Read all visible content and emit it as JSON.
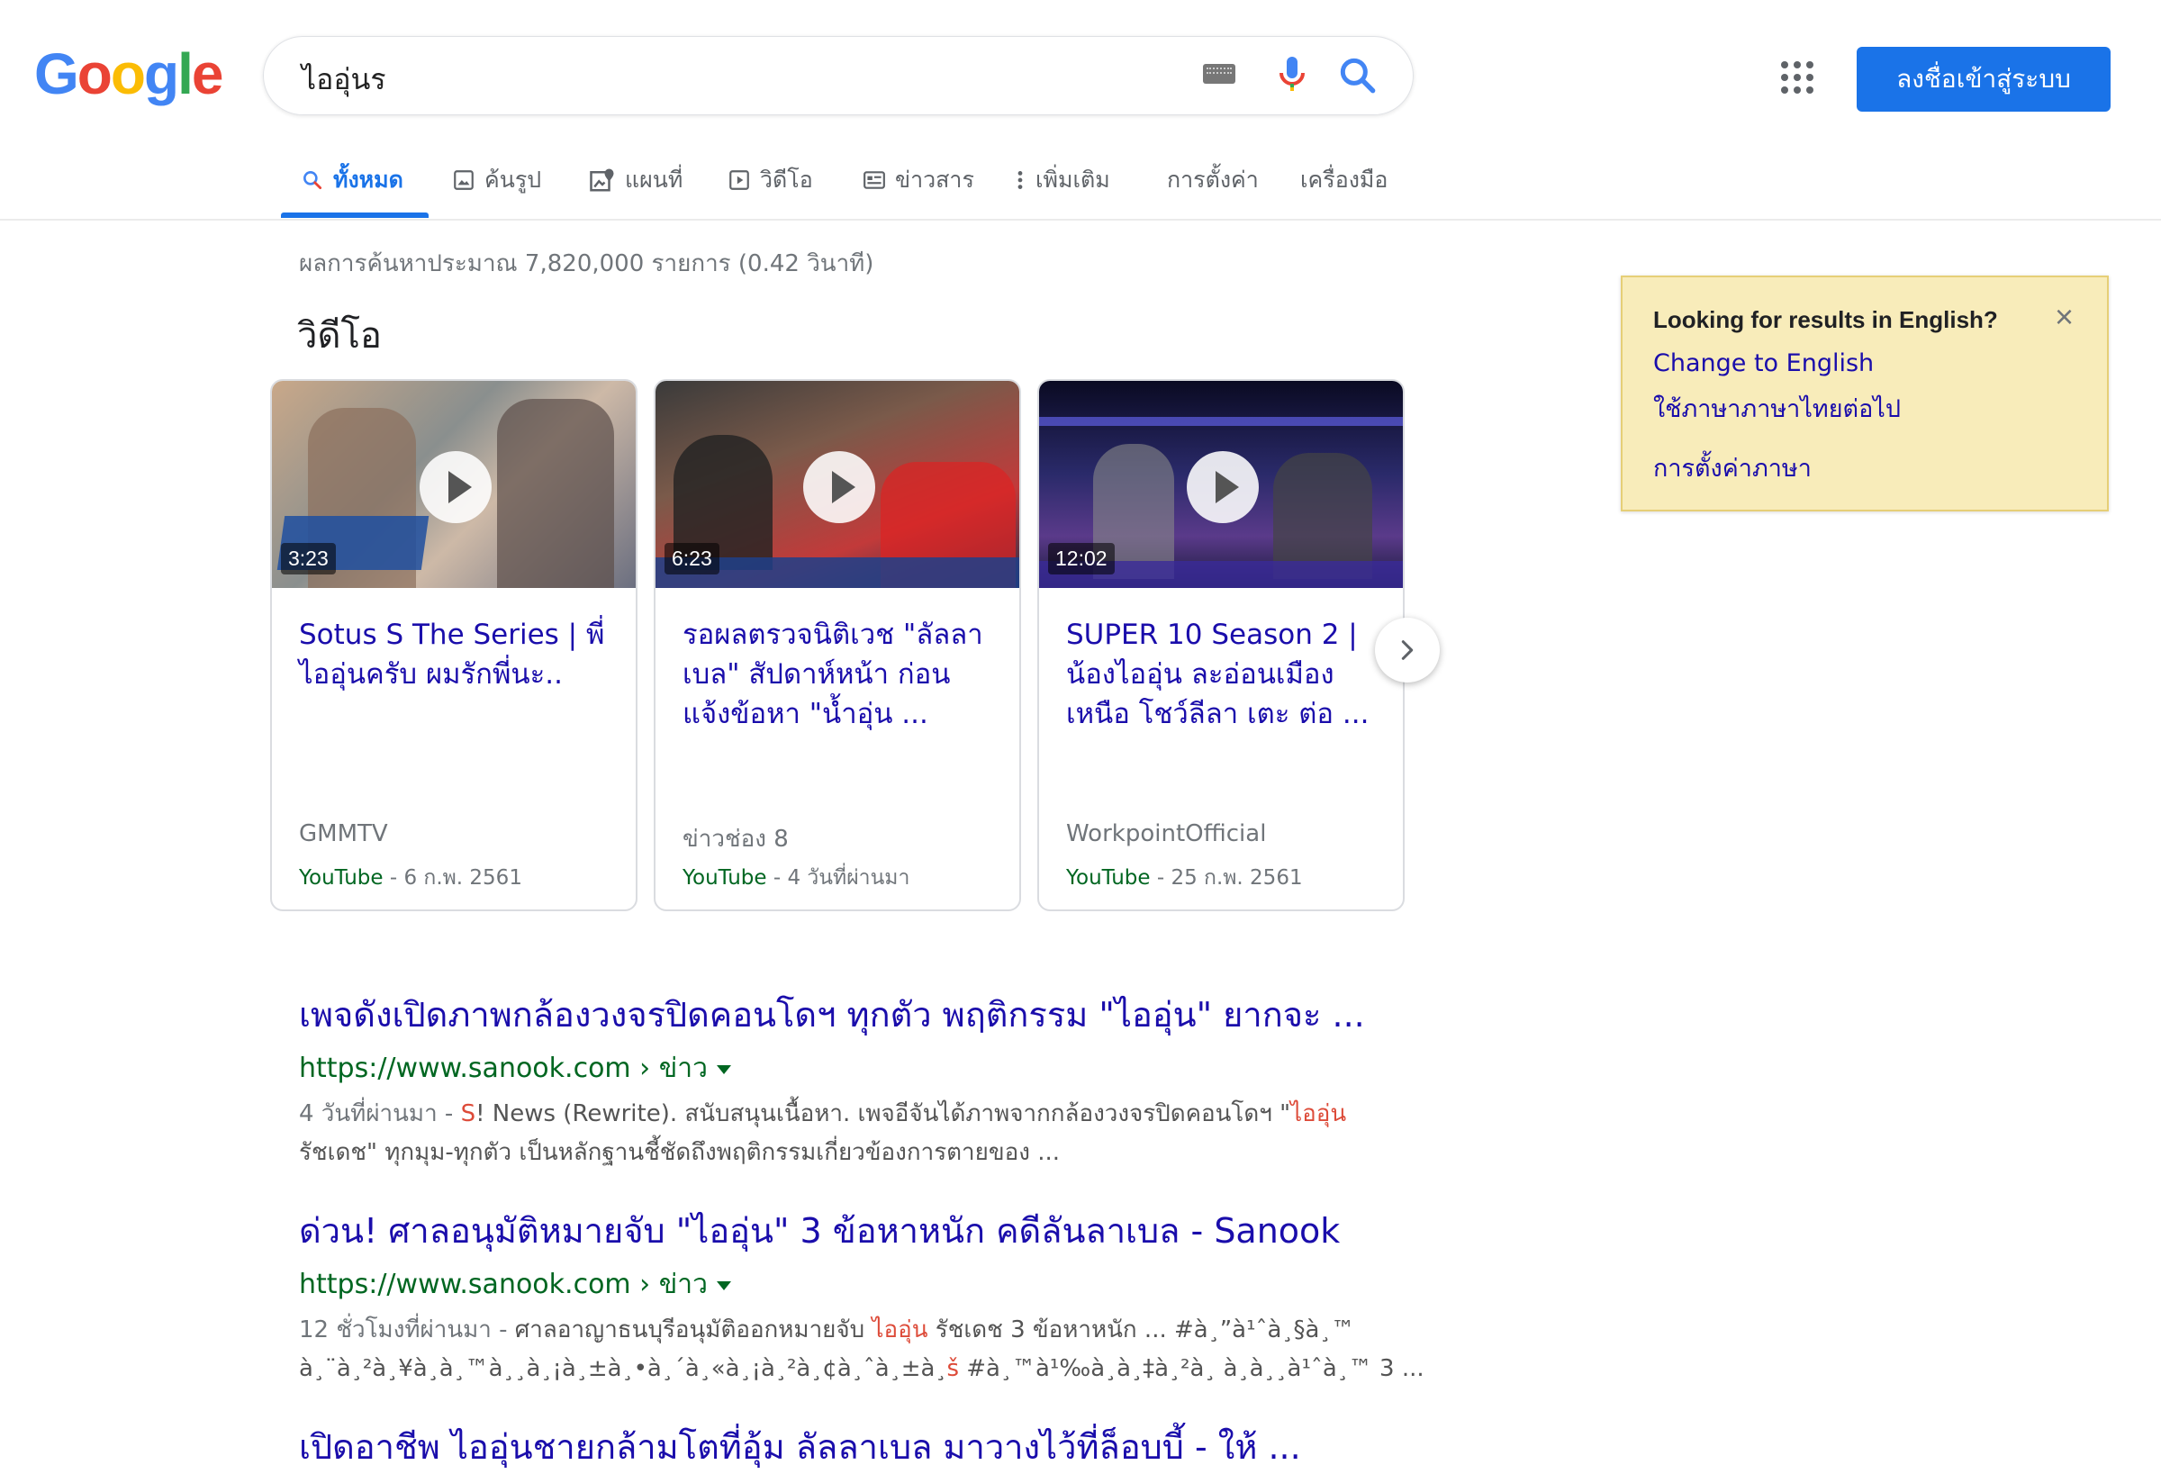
{
  "header": {
    "logo_letters": [
      "G",
      "o",
      "o",
      "g",
      "l",
      "e"
    ],
    "logo_colors": [
      "#4285F4",
      "#EA4335",
      "#FBBC05",
      "#4285F4",
      "#34A853",
      "#EA4335"
    ],
    "query": "ไออุ่นร",
    "signin_label": "ลงชื่อเข้าสู่ระบบ"
  },
  "tabs": {
    "all": "ทั้งหมด",
    "images": "ค้นรูป",
    "maps": "แผนที่",
    "videos": "วิดีโอ",
    "news": "ข่าวสาร",
    "more": "เพิ่มเติม",
    "settings": "การตั้งค่า",
    "tools": "เครื่องมือ"
  },
  "stats": "ผลการค้นหาประมาณ 7,820,000 รายการ (0.42 วินาที)",
  "videos_section": {
    "title": "วิดีโอ",
    "cards": [
      {
        "duration": "3:23",
        "title": "Sotus S The Series | พี่ไออุ่นครับ ผมรักพี่นะ..",
        "channel": "GMMTV",
        "source": "YouTube",
        "date": " - 6 ก.พ. 2561"
      },
      {
        "duration": "6:23",
        "title": "รอผลตรวจนิติเวช \"ลัลลาเบล\" สัปดาห์หน้า ก่อนแจ้งข้อหา \"น้ำอุ่น ...",
        "channel": "ข่าวช่อง 8",
        "source": "YouTube",
        "date": " - 4 วันที่ผ่านมา"
      },
      {
        "duration": "12:02",
        "title": "SUPER 10 Season 2 | น้องไออุ่น ละอ่อนเมืองเหนือ โชว์ลีลา เตะ ต่อ ...",
        "channel": "WorkpointOfficial",
        "source": "YouTube",
        "date": " - 25 ก.พ. 2561"
      }
    ]
  },
  "notice": {
    "title": "Looking for results in English?",
    "close": "×",
    "change": "Change to English",
    "keep": "ใช้ภาษาภาษาไทยต่อไป",
    "lang_settings": "การตั้งค่าภาษา"
  },
  "results": [
    {
      "title": "เพจดังเปิดภาพกล้องวงจรปิดคอนโดฯ ทุกตัว พฤติกรรม \"ไออุ่น\" ยากจะ ...",
      "url": "https://www.sanook.com › ข่าว",
      "snippet_date": "4 วันที่ผ่านมา - ",
      "snippet_hl1": "S",
      "snippet_l1": "! News (Rewrite). สนับสนุนเนื้อหา. เพจอีจันได้ภาพจากกล้องวงจรปิดคอนโดฯ \"",
      "snippet_hl2": "ไออุ่น",
      "snippet_line2": "รัชเดช\" ทุกมุม-ทุกตัว เป็นหลักฐานชี้ชัดถึงพฤติกรรมเกี่ยวข้องการตายของ ..."
    },
    {
      "title": "ด่วน! ศาลอนุมัติหมายจับ \"ไออุ่น\" 3 ข้อหาหนัก คดีลันลาเบล - Sanook",
      "url": "https://www.sanook.com › ข่าว",
      "snippet_date": "12 ชั่วโมงที่ผ่านมา - ",
      "snippet_l1": "ศาลอาญาธนบุรีอนุมัติออกหมายจับ ",
      "snippet_hl1": "ไออุ่น",
      "snippet_l1b": " รัชเดช 3 ข้อหาหนัก ... #à¸”à¹ˆà¸§à¸™",
      "snippet_line2a": "à¸¨à¸²à¸¥à¸­à¸™à¸¸à¸¡à¸±à¸•à¸´à¸«à¸¡à¸²à¸¢à¸ˆà¸±à¸",
      "snippet_hl2": "š",
      "snippet_line2b": " #à¸™à¹‰à¸­à¸‡à¸²à¸ à¸­à¸¸à¹ˆà¸™ 3 ..."
    },
    {
      "title": "เปิดอาชีพ ไออุ่นชายกล้ามโตที่อุ้ม ลัลลาเบล มาวางไว้ที่ล็อบบี้ - ให้ ..."
    }
  ]
}
